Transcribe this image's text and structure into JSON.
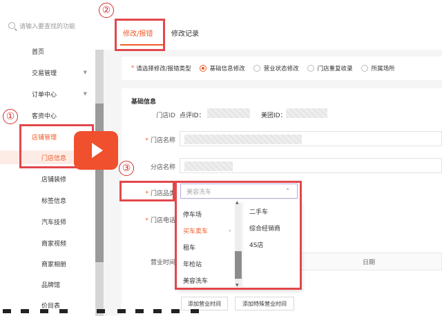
{
  "search": {
    "placeholder": "请输入要查找的功能"
  },
  "sidebar": {
    "items": [
      {
        "label": "首页"
      },
      {
        "label": "交易管理",
        "chevron": "▼"
      },
      {
        "label": "订单中心",
        "chevron": "▼"
      },
      {
        "label": "客资中心"
      },
      {
        "label": "店铺管理",
        "active": true
      },
      {
        "label": "门店信息",
        "active": true
      },
      {
        "label": "店铺装修"
      },
      {
        "label": "标签信息"
      },
      {
        "label": "汽车技师"
      },
      {
        "label": "商家视频"
      },
      {
        "label": "商家相册"
      },
      {
        "label": "品牌馆"
      },
      {
        "label": "价目表"
      }
    ]
  },
  "tabs": {
    "edit": "修改/报错",
    "record": "修改记录"
  },
  "type_select": {
    "label": "请选择修改/报错类型",
    "options": [
      "基础信息修改",
      "营业状态修改",
      "门店重复收录",
      "所属场所"
    ],
    "selected": 0
  },
  "form": {
    "section_title": "基础信息",
    "store_id_label": "门店ID",
    "dianping_id_label": "点评ID：",
    "meituan_id_label": "美团ID：",
    "store_name_label": "门店名称",
    "branch_name_label": "分店名称",
    "category_label": "门店品类",
    "category_value": "美容洗车",
    "phone_label": "门店电话",
    "hours_label": "营业时间",
    "hours_table_header": "日期",
    "add_hours_button": "添加营业时间",
    "add_special_hours_button": "添加特殊营业时间"
  },
  "dropdown": {
    "column1": [
      "停车场",
      "买车卖车",
      "租车",
      "年检站",
      "美容洗车"
    ],
    "active_index": 1,
    "column2": [
      "二手车",
      "综合经销商",
      "4S店"
    ]
  },
  "annotations": [
    "①",
    "②",
    "③"
  ],
  "colors": {
    "accent": "#f05a28",
    "annotation": "#e2474b"
  }
}
